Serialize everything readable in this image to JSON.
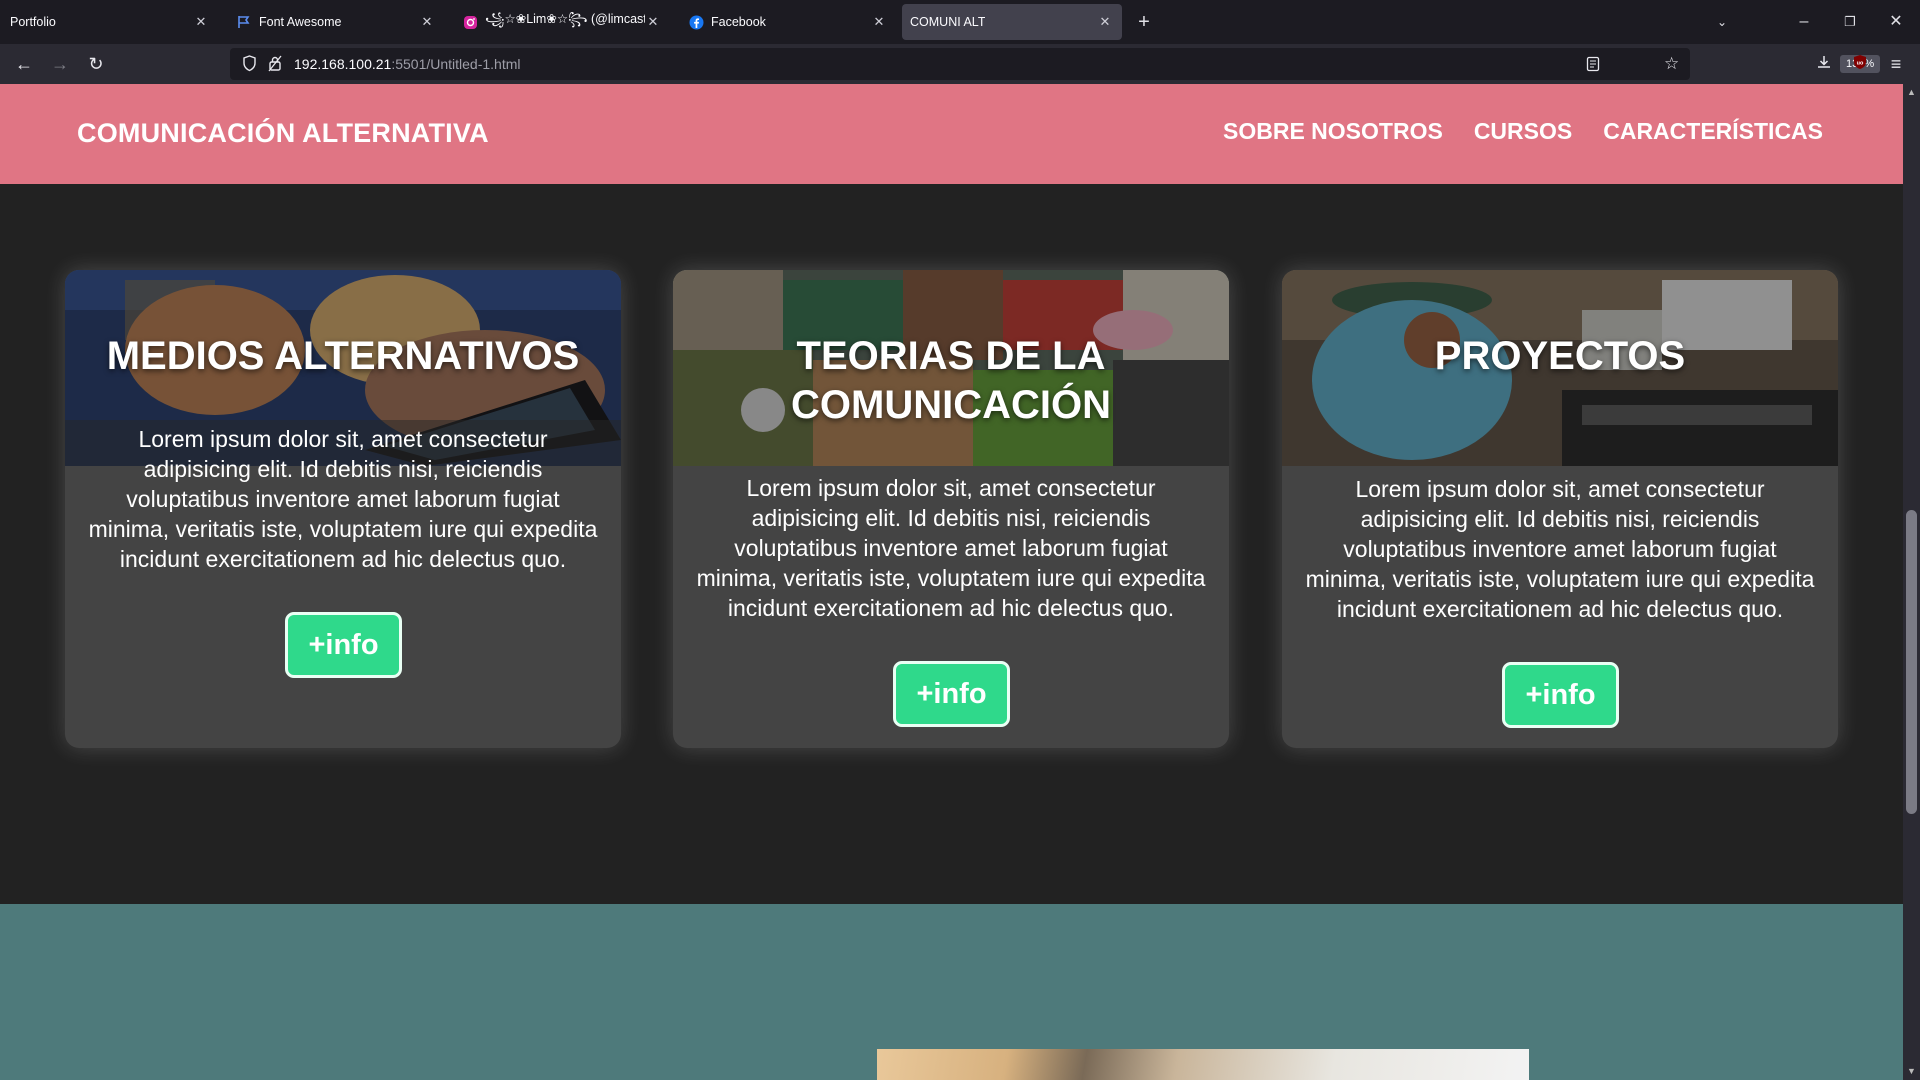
{
  "browser": {
    "tabs": [
      {
        "label": "Portfolio",
        "icon": "none"
      },
      {
        "label": "Font Awesome",
        "icon": "flag-icon"
      },
      {
        "label": "꧁☆❀Lim❀☆꧂ (@limcast_)",
        "icon": "instagram-icon"
      },
      {
        "label": "Facebook",
        "icon": "facebook-icon"
      },
      {
        "label": "COMUNI ALT",
        "icon": "none",
        "active": true
      }
    ],
    "url_host": "192.168.100.21",
    "url_path": ":5501/Untitled-1.html",
    "zoom": "130%"
  },
  "site": {
    "brand": "COMUNICACIÓN ALTERNATIVA",
    "menu": [
      "SOBRE NOSOTROS",
      "CURSOS",
      "CARACTERÍSTICAS"
    ],
    "cards": [
      {
        "title": "MEDIOS ALTERNATIVOS",
        "text": "Lorem ipsum dolor sit, amet consectetur adipisicing elit. Id debitis nisi, reiciendis voluptatibus inventore amet laborum fugiat minima, veritatis iste, voluptatem iure qui expedita incidunt exercitationem ad hic delectus quo.",
        "button": "+info"
      },
      {
        "title": "TEORIAS DE LA COMUNICACIÓN",
        "text": "Lorem ipsum dolor sit, amet consectetur adipisicing elit. Id debitis nisi, reiciendis voluptatibus inventore amet laborum fugiat minima, veritatis iste, voluptatem iure qui expedita incidunt exercitationem ad hic delectus quo.",
        "button": "+info"
      },
      {
        "title": "PROYECTOS",
        "text": "Lorem ipsum dolor sit, amet consectetur adipisicing elit. Id debitis nisi, reiciendis voluptatibus inventore amet laborum fugiat minima, veritatis iste, voluptatem iure qui expedita incidunt exercitationem ad hic delectus quo.",
        "button": "+info"
      }
    ]
  },
  "colors": {
    "header": "#e07584",
    "card": "#444444",
    "button": "#2fd98b",
    "teal_section": "#4e7a7b"
  }
}
